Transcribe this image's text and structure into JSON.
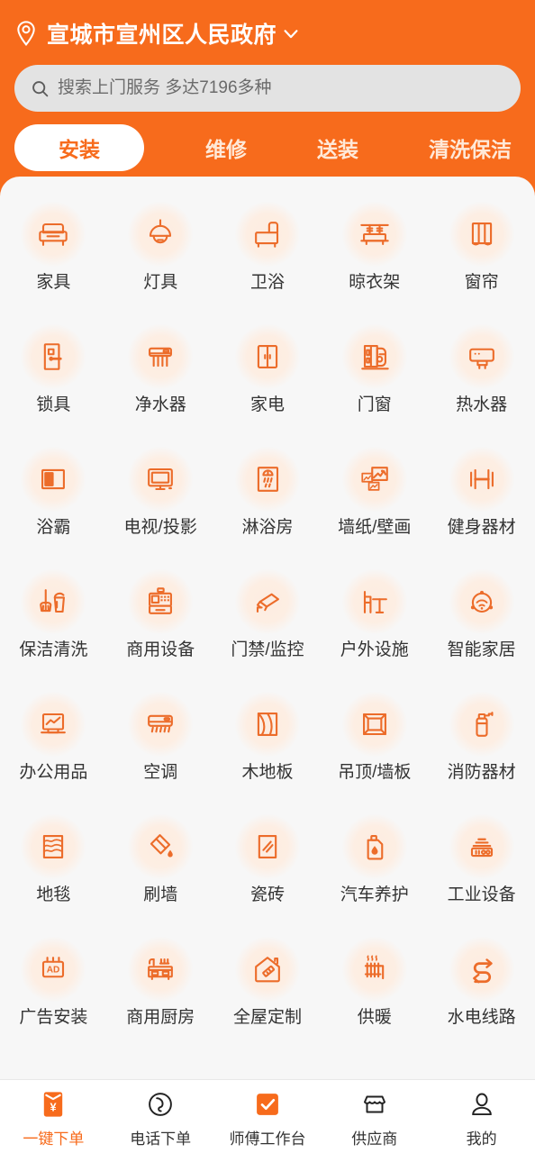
{
  "header": {
    "location_name": "宣城市宣州区人民政府",
    "location_pin_icon": "location-pin-icon",
    "caret_icon": "chevron-down-icon",
    "accent_color": "#f76b1c",
    "text_color": "#ffffff"
  },
  "search": {
    "placeholder": "搜索上门服务 多达7196多种",
    "icon": "search-icon",
    "background_color": "#e3e3e3",
    "text_color": "#6b6b6b"
  },
  "tabs": [
    {
      "label": "安装",
      "active": true
    },
    {
      "label": "维修",
      "active": false
    },
    {
      "label": "送装",
      "active": false
    },
    {
      "label": "清洗保洁",
      "active": false
    }
  ],
  "panel": {
    "background_color": "#f7f7f7",
    "icon_color": "#ec6c2a",
    "icon_bg_color": "#fdeee3"
  },
  "categories": [
    {
      "label": "家具",
      "icon": "armchair-icon"
    },
    {
      "label": "灯具",
      "icon": "pendant-lamp-icon"
    },
    {
      "label": "卫浴",
      "icon": "bathtub-icon"
    },
    {
      "label": "晾衣架",
      "icon": "clothes-drying-rack-icon"
    },
    {
      "label": "窗帘",
      "icon": "curtain-icon"
    },
    {
      "label": "锁具",
      "icon": "door-lock-icon"
    },
    {
      "label": "净水器",
      "icon": "water-purifier-icon"
    },
    {
      "label": "家电",
      "icon": "cabinet-appliance-icon"
    },
    {
      "label": "门窗",
      "icon": "door-window-icon"
    },
    {
      "label": "热水器",
      "icon": "water-heater-icon"
    },
    {
      "label": "浴霸",
      "icon": "bath-heater-icon"
    },
    {
      "label": "电视/投影",
      "icon": "television-icon"
    },
    {
      "label": "淋浴房",
      "icon": "shower-room-icon"
    },
    {
      "label": "墙纸/壁画",
      "icon": "wallpaper-picture-icon"
    },
    {
      "label": "健身器材",
      "icon": "dumbbell-icon"
    },
    {
      "label": "保洁清洗",
      "icon": "broom-bucket-icon"
    },
    {
      "label": "商用设备",
      "icon": "cash-register-icon"
    },
    {
      "label": "门禁/监控",
      "icon": "cctv-camera-icon"
    },
    {
      "label": "户外设施",
      "icon": "outdoor-table-chair-icon"
    },
    {
      "label": "智能家居",
      "icon": "smart-home-wifi-icon"
    },
    {
      "label": "办公用品",
      "icon": "laptop-icon"
    },
    {
      "label": "空调",
      "icon": "air-conditioner-icon"
    },
    {
      "label": "木地板",
      "icon": "wood-floor-icon"
    },
    {
      "label": "吊顶/墙板",
      "icon": "ceiling-panel-icon"
    },
    {
      "label": "消防器材",
      "icon": "fire-extinguisher-icon"
    },
    {
      "label": "地毯",
      "icon": "carpet-icon"
    },
    {
      "label": "刷墙",
      "icon": "paint-bucket-icon"
    },
    {
      "label": "瓷砖",
      "icon": "tile-icon"
    },
    {
      "label": "汽车养护",
      "icon": "oil-can-icon"
    },
    {
      "label": "工业设备",
      "icon": "industrial-machine-icon"
    },
    {
      "label": "广告安装",
      "icon": "ad-board-icon"
    },
    {
      "label": "商用厨房",
      "icon": "commercial-kitchen-icon"
    },
    {
      "label": "全屋定制",
      "icon": "house-ruler-icon"
    },
    {
      "label": "供暖",
      "icon": "radiator-icon"
    },
    {
      "label": "水电线路",
      "icon": "pipe-wiring-icon"
    }
  ],
  "bottom_nav": [
    {
      "label": "一键下单",
      "icon": "red-packet-yuan-icon",
      "active": true
    },
    {
      "label": "电话下单",
      "icon": "phone-handset-icon",
      "active": false
    },
    {
      "label": "师傅工作台",
      "icon": "checkmark-square-icon",
      "active": false
    },
    {
      "label": "供应商",
      "icon": "storefront-icon",
      "active": false
    },
    {
      "label": "我的",
      "icon": "user-profile-icon",
      "active": false
    }
  ]
}
